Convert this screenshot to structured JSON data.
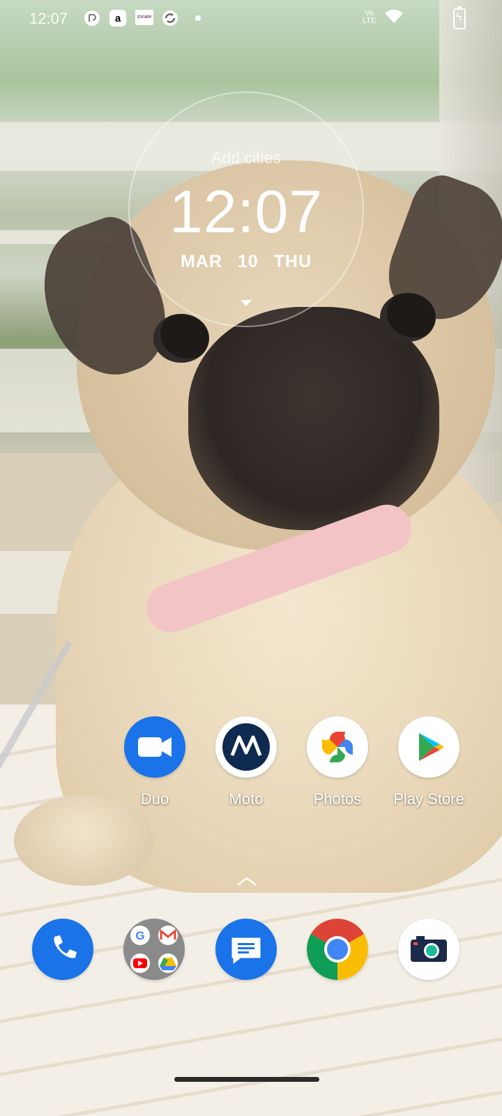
{
  "status_bar": {
    "time": "12:07",
    "notification_icons": [
      "rotate-notification-icon",
      "amazon-icon",
      "news-icon",
      "sync-icon"
    ],
    "amazon_letter": "a",
    "news_label": "zonate",
    "network_label_top": "Vo",
    "network_label_bottom": "LTE"
  },
  "clock_widget": {
    "add_cities": "Add cities",
    "time": "12:07",
    "date": "MAR 10 THU"
  },
  "apps": [
    {
      "label": "Duo",
      "color": "#1a73e8"
    },
    {
      "label": "Moto",
      "color": "#ffffff"
    },
    {
      "label": "Photos",
      "color": "#ffffff"
    },
    {
      "label": "Play Store",
      "color": "#ffffff"
    }
  ],
  "dock": [
    {
      "name": "phone",
      "color": "#1a73e8"
    },
    {
      "name": "google-folder",
      "color": "#8a8a8a"
    },
    {
      "name": "messages",
      "color": "#1a73e8"
    },
    {
      "name": "chrome",
      "color": "#ffffff"
    },
    {
      "name": "camera",
      "color": "#ffffff"
    }
  ]
}
